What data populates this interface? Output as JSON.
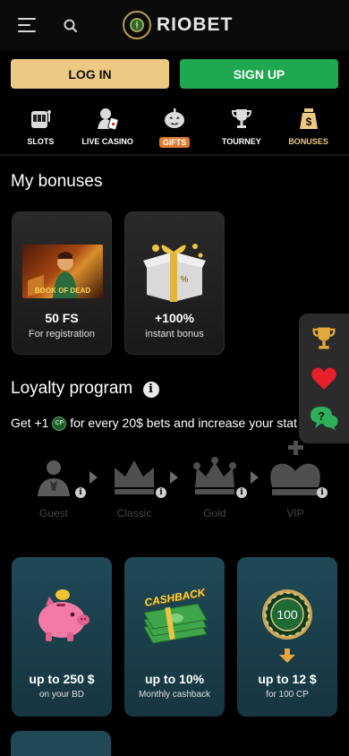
{
  "header": {
    "brand": "RIOBET"
  },
  "auth": {
    "login_label": "LOG IN",
    "signup_label": "SIGN UP"
  },
  "tabs": [
    {
      "label": "SLOTS",
      "icon": "slot-machine-icon"
    },
    {
      "label": "LIVE CASINO",
      "icon": "live-dealer-icon"
    },
    {
      "label": "GIFTS",
      "icon": "pumpkin-icon"
    },
    {
      "label": "TOURNEY",
      "icon": "trophy-icon"
    },
    {
      "label": "BONUSES",
      "icon": "money-bag-icon"
    }
  ],
  "my_bonuses": {
    "title": "My bonuses",
    "cards": [
      {
        "value": "50 FS",
        "subtitle": "For registration",
        "image_text": "BOOK OF DEAD"
      },
      {
        "value": "+100%",
        "subtitle": "instant bonus"
      }
    ]
  },
  "side_panel": {
    "icons": [
      "trophy-icon",
      "heart-icon",
      "chat-help-icon"
    ]
  },
  "loyalty": {
    "title": "Loyalty program",
    "description_prefix": "Get +1",
    "cp_badge": "CP",
    "description_suffix": "for every 20$ bets and increase your stat",
    "levels": [
      "Guest",
      "Classic",
      "Gold",
      "VIP"
    ]
  },
  "perks": [
    {
      "value": "up to 250 $",
      "subtitle": "on your BD",
      "icon": "piggy-bank-icon"
    },
    {
      "value": "up to 10%",
      "subtitle": "Monthly cashback",
      "icon": "cashback-money-icon",
      "image_text": "CASHBACK"
    },
    {
      "value": "up to 12 $",
      "subtitle": "for 100 CP",
      "icon": "chip-exchange-icon",
      "chip_value": "100"
    }
  ],
  "colors": {
    "accent_gold": "#edc983",
    "signup_green": "#1ea84f",
    "gifts_orange": "#e07b2e",
    "perk_bg": "#1f4956"
  }
}
